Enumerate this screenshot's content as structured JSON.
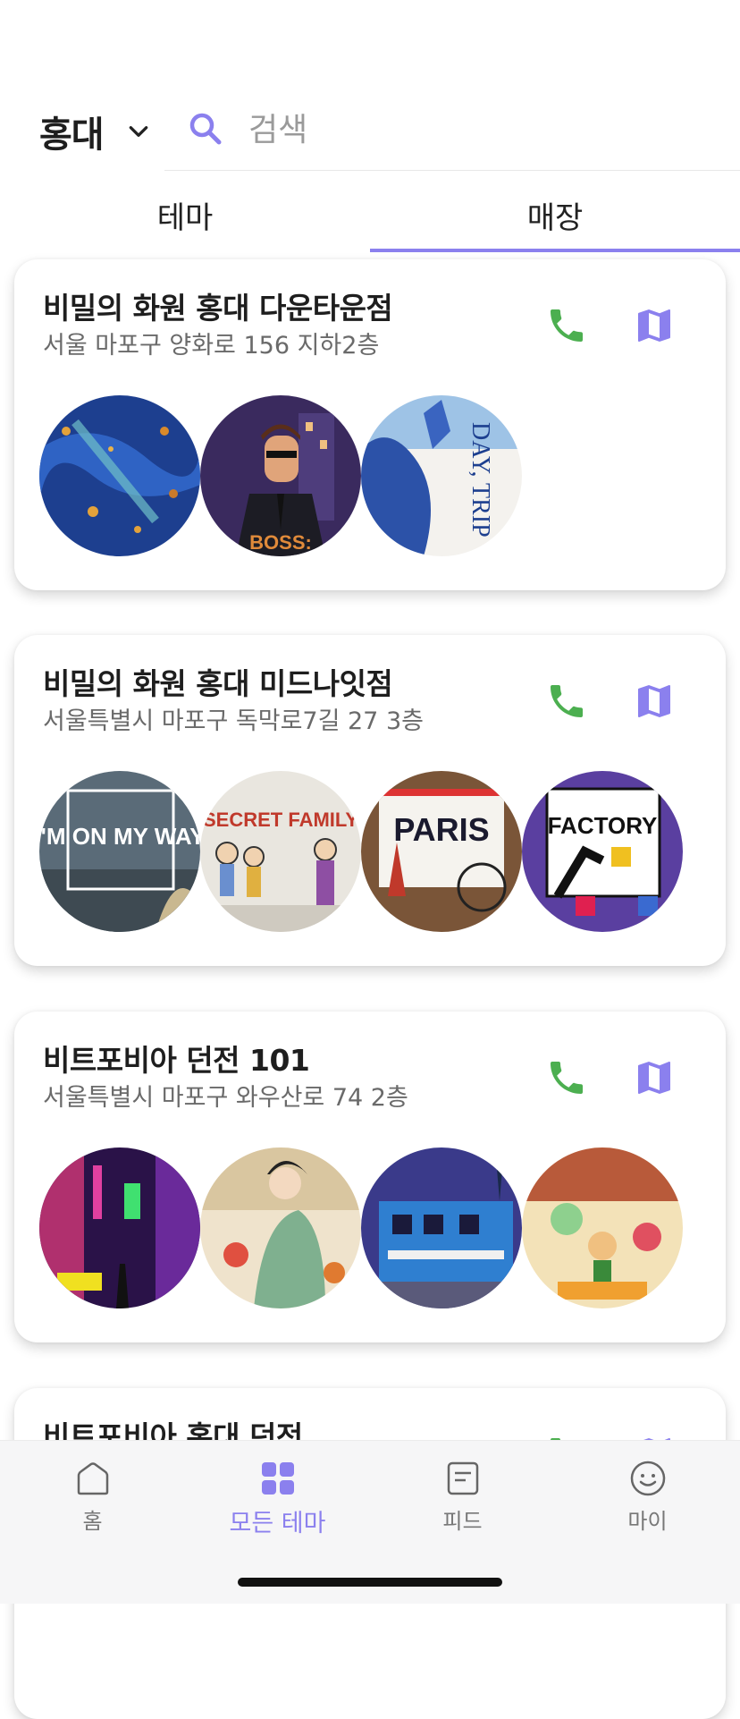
{
  "header": {
    "region": "홍대",
    "search_placeholder": "검색"
  },
  "tabs": [
    {
      "label": "테마",
      "active": false
    },
    {
      "label": "매장",
      "active": true
    }
  ],
  "stores": [
    {
      "name": "비밀의 화원 홍대 다운타운점",
      "address": "서울 마포구 양화로 156 지하2층",
      "themes": [
        {
          "image": "blue abstract poster"
        },
        {
          "image": "boss character poster",
          "text": "BOSS:"
        },
        {
          "image": "day trip poster",
          "text": "DAY, TRIP"
        }
      ]
    },
    {
      "name": "비밀의 화원 홍대 미드나잇점",
      "address": "서울특별시 마포구 독막로7길 27 3층",
      "themes": [
        {
          "image": "street poster",
          "text": "I'M ON MY WAY"
        },
        {
          "image": "family poster",
          "text": "SECRET FAMILY"
        },
        {
          "image": "paris poster",
          "text": "PARIS"
        },
        {
          "image": "factory poster",
          "text": "FACTORY"
        }
      ]
    },
    {
      "name": "비트포비아 던전 101",
      "address": "서울특별시 마포구 와우산로 74 2층",
      "themes": [
        {
          "image": "neon alley poster"
        },
        {
          "image": "hanbok woman poster"
        },
        {
          "image": "blue building poster"
        },
        {
          "image": "cartoon characters poster"
        }
      ]
    },
    {
      "name": "비트포비아 홍대 던전",
      "address": "",
      "themes": []
    }
  ],
  "bottom_nav": [
    {
      "label": "홈",
      "icon": "home-icon",
      "active": false
    },
    {
      "label": "모든 테마",
      "icon": "grid-icon",
      "active": true
    },
    {
      "label": "피드",
      "icon": "feed-icon",
      "active": false
    },
    {
      "label": "마이",
      "icon": "smiley-icon",
      "active": false
    }
  ],
  "colors": {
    "accent": "#8b80ee",
    "phone": "#4caf50"
  }
}
